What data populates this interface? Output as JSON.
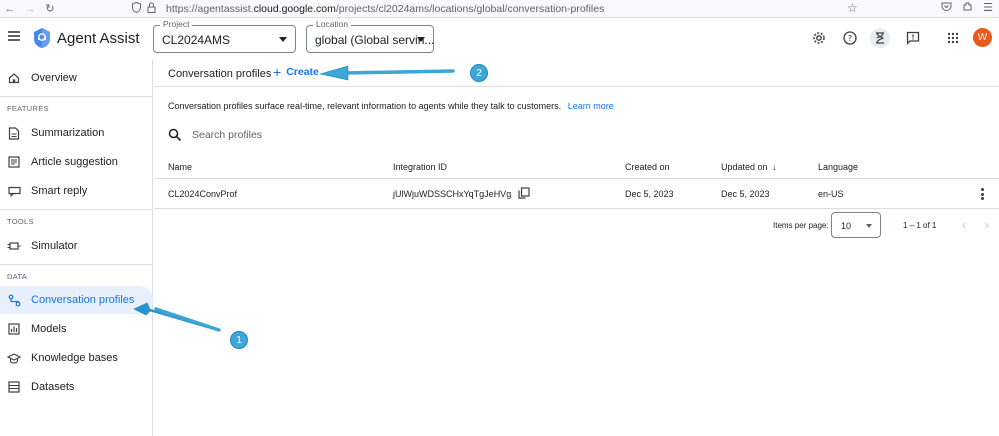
{
  "browser": {
    "url_prefix": "https://agentassist.",
    "url_domain": "cloud.google.com",
    "url_path": "/projects/cl2024ams/locations/global/conversation-profiles"
  },
  "header": {
    "app_name": "Agent Assist",
    "project": {
      "label": "Project",
      "value": "CL2024AMS"
    },
    "location": {
      "label": "Location",
      "value": "global (Global servin..."
    },
    "avatar_initial": "W",
    "avatar_color": "#e8591a"
  },
  "sidebar": {
    "overview": "Overview",
    "features_label": "FEATURES",
    "summarization": "Summarization",
    "article_suggestion": "Article suggestion",
    "smart_reply": "Smart reply",
    "tools_label": "TOOLS",
    "simulator": "Simulator",
    "data_label": "DATA",
    "conversation_profiles": "Conversation profiles",
    "models": "Models",
    "knowledge_bases": "Knowledge bases",
    "datasets": "Datasets"
  },
  "main": {
    "title": "Conversation profiles",
    "create_label": "Create",
    "description": "Conversation profiles surface real-time, relevant information to agents while they talk to customers.",
    "learn_more": "Learn more",
    "search_placeholder": "Search profiles",
    "columns": {
      "name": "Name",
      "integration_id": "Integration ID",
      "created_on": "Created on",
      "updated_on": "Updated on",
      "language": "Language"
    },
    "rows": [
      {
        "name": "CL2024ConvProf",
        "integration_id": "jUlWjuWDSSCHxYqTgJeHVg",
        "created_on": "Dec 5, 2023",
        "updated_on": "Dec 5, 2023",
        "language": "en-US"
      }
    ],
    "pagination": {
      "items_per_page_label": "Items per page:",
      "items_per_page": "10",
      "range": "1 – 1 of 1"
    }
  },
  "annotations": {
    "callout_1": "1",
    "callout_2": "2",
    "accent_color": "#3aa7d8"
  }
}
